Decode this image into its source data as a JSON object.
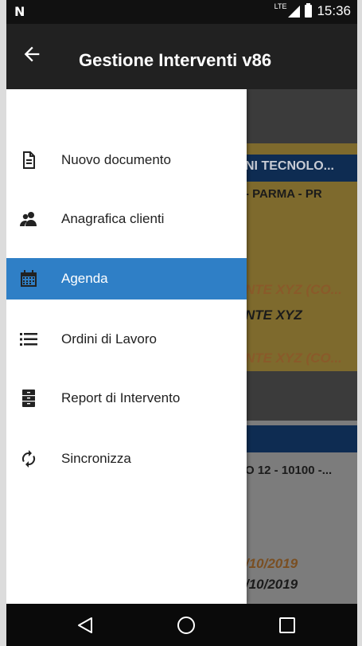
{
  "status_bar": {
    "carrier_icon": "N",
    "network": "LTE",
    "time": "15:36"
  },
  "app_bar": {
    "title": "Gestione Interventi v86"
  },
  "drawer": {
    "items": [
      {
        "label": "Nuovo documento",
        "icon": "document-icon"
      },
      {
        "label": "Anagrafica clienti",
        "icon": "people-icon"
      },
      {
        "label": "Agenda",
        "icon": "calendar-icon",
        "active": true
      },
      {
        "label": "Ordini di Lavoro",
        "icon": "list-icon"
      },
      {
        "label": "Report di Intervento",
        "icon": "report-icon"
      },
      {
        "label": "Sincronizza",
        "icon": "sync-icon"
      }
    ]
  },
  "background": {
    "card1_header": "NI TECNOLO...",
    "card1_address": "- PARMA - PR",
    "card1_client_a": "NTE XYZ (CO...",
    "card1_client_b": "NTE XYZ",
    "card1_client_c": "NTE XYZ (CO...",
    "card2_address": "O 12 - 10100 -...",
    "card2_date_a": "/10/2019",
    "card2_date_b": "/10/2019"
  },
  "colors": {
    "accent": "#2f7fc6",
    "app_bar": "#212121",
    "card_header": "#0e2c52"
  }
}
